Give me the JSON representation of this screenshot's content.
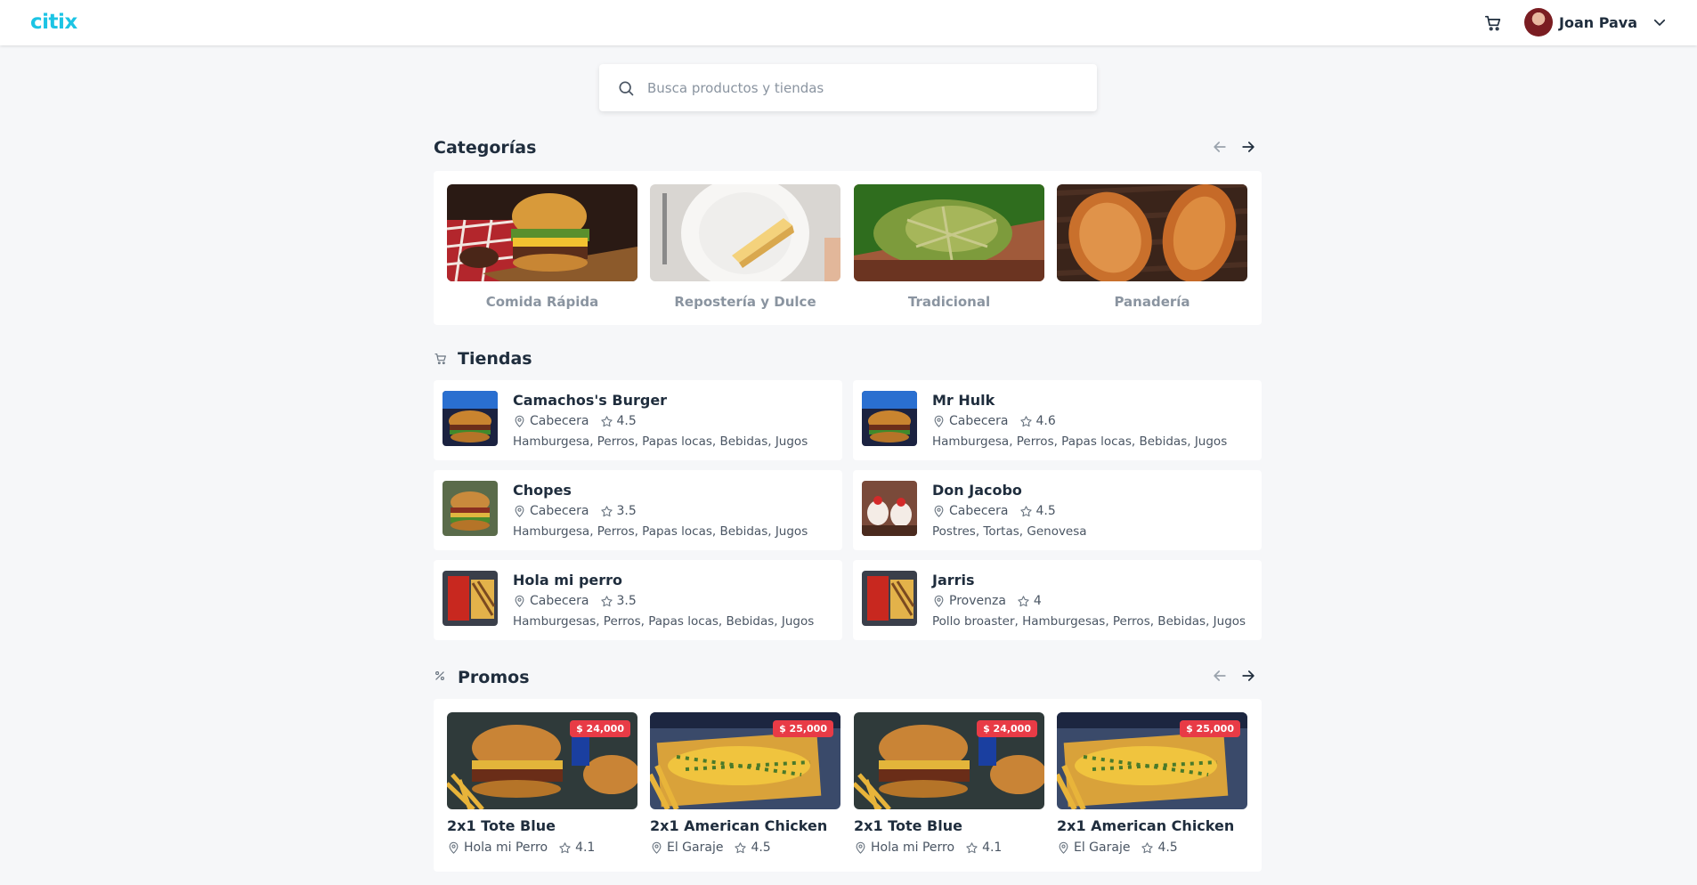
{
  "header": {
    "logo": "citix",
    "user_name": "Joan Pava",
    "icons": {
      "cart": "cart-icon",
      "dropdown": "chevron-down-icon"
    }
  },
  "search": {
    "placeholder": "Busca productos y tiendas",
    "value": ""
  },
  "categories": {
    "title": "Categorías",
    "items": [
      {
        "label": "Comida Rápida"
      },
      {
        "label": "Repostería y Dulce"
      },
      {
        "label": "Tradicional"
      },
      {
        "label": "Panadería"
      }
    ]
  },
  "stores": {
    "title": "Tiendas",
    "items": [
      {
        "name": "Camachos's Burger",
        "location": "Cabecera",
        "rating": "4.5",
        "tags": "Hamburgesa, Perros, Papas locas, Bebidas, Jugos"
      },
      {
        "name": "Mr Hulk",
        "location": "Cabecera",
        "rating": "4.6",
        "tags": "Hamburgesa, Perros, Papas locas, Bebidas, Jugos"
      },
      {
        "name": "Chopes",
        "location": "Cabecera",
        "rating": "3.5",
        "tags": "Hamburgesa, Perros, Papas locas, Bebidas, Jugos"
      },
      {
        "name": "Don Jacobo",
        "location": "Cabecera",
        "rating": "4.5",
        "tags": "Postres, Tortas, Genovesa"
      },
      {
        "name": "Hola mi perro",
        "location": "Cabecera",
        "rating": "3.5",
        "tags": "Hamburgesas, Perros, Papas locas, Bebidas, Jugos"
      },
      {
        "name": "Jarris",
        "location": "Provenza",
        "rating": "4",
        "tags": "Pollo broaster, Hamburgesas, Perros, Bebidas, Jugos"
      }
    ]
  },
  "promos": {
    "title": "Promos",
    "items": [
      {
        "title": "2x1 Tote Blue",
        "price": "$ 24,000",
        "store": "Hola mi Perro",
        "rating": "4.1"
      },
      {
        "title": "2x1 American Chicken",
        "price": "$ 25,000",
        "store": "El Garaje",
        "rating": "4.5"
      },
      {
        "title": "2x1 Tote Blue",
        "price": "$ 24,000",
        "store": "Hola mi Perro",
        "rating": "4.1"
      },
      {
        "title": "2x1 American Chicken",
        "price": "$ 25,000",
        "store": "El Garaje",
        "rating": "4.5"
      }
    ]
  },
  "colors": {
    "brand": "#1cc4e4",
    "price_badge": "#e83b46",
    "background": "#f6f7f9"
  }
}
